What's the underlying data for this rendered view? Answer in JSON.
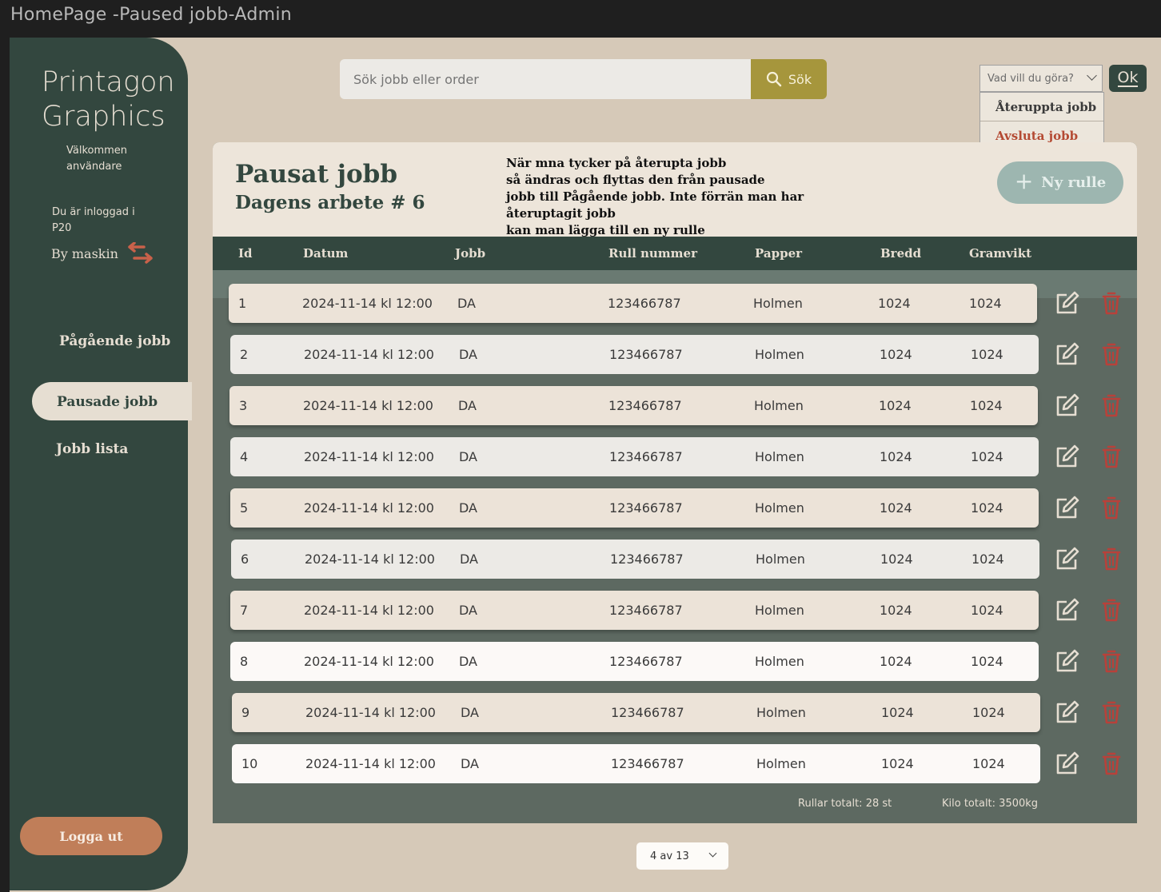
{
  "window": {
    "title": "HomePage -Paused jobb-Admin"
  },
  "sidebar": {
    "brand_line1": "Printagon",
    "brand_line2": "Graphics",
    "welcome_line1": "Välkommen",
    "welcome_line2": "användare",
    "logged_line1": "Du är inloggad i",
    "logged_line2": "P20",
    "switch_label": "By maskin",
    "nav": [
      "Pågående jobb",
      "Pausade jobb",
      "Jobb lista"
    ],
    "active_nav": "Pausade jobb",
    "logout": "Logga ut"
  },
  "search": {
    "placeholder": "Sök jobb eller order",
    "button": "Sök"
  },
  "actions": {
    "placeholder": "Vad vill du göra?",
    "options": [
      "Återuppta jobb",
      "Avsluta jobb"
    ],
    "ok": "Ok"
  },
  "panel": {
    "title": "Pausat jobb",
    "subtitle": "Dagens arbete # 6",
    "note_lines": [
      "När mna tycker på återupta jobb",
      "så ändras och flyttas den från pausade",
      "jobb till Pågående jobb. Inte förrän man har återuptagit jobb",
      "kan man lägga till en ny rulle"
    ],
    "new_roll": "Ny rulle"
  },
  "table": {
    "columns": [
      "Id",
      "Datum",
      "Jobb",
      "Rull nummer",
      "Papper",
      "Bredd",
      "Gramvikt"
    ],
    "rows": [
      [
        "1",
        "2024-11-14 kl 12:00",
        "DA",
        "123466787",
        "Holmen",
        "1024",
        "1024"
      ],
      [
        "2",
        "2024-11-14 kl 12:00",
        "DA",
        "123466787",
        "Holmen",
        "1024",
        "1024"
      ],
      [
        "3",
        "2024-11-14 kl 12:00",
        "DA",
        "123466787",
        "Holmen",
        "1024",
        "1024"
      ],
      [
        "4",
        "2024-11-14 kl 12:00",
        "DA",
        "123466787",
        "Holmen",
        "1024",
        "1024"
      ],
      [
        "5",
        "2024-11-14 kl 12:00",
        "DA",
        "123466787",
        "Holmen",
        "1024",
        "1024"
      ],
      [
        "6",
        "2024-11-14 kl 12:00",
        "DA",
        "123466787",
        "Holmen",
        "1024",
        "1024"
      ],
      [
        "7",
        "2024-11-14 kl 12:00",
        "DA",
        "123466787",
        "Holmen",
        "1024",
        "1024"
      ],
      [
        "8",
        "2024-11-14 kl 12:00",
        "DA",
        "123466787",
        "Holmen",
        "1024",
        "1024"
      ],
      [
        "9",
        "2024-11-14 kl 12:00",
        "DA",
        "123466787",
        "Holmen",
        "1024",
        "1024"
      ],
      [
        "10",
        "2024-11-14 kl 12:00",
        "DA",
        "123466787",
        "Holmen",
        "1024",
        "1024"
      ]
    ],
    "totals": {
      "rolls": "Rullar totalt: 28 st",
      "kilo": "Kilo totalt: 3500kg"
    }
  },
  "pagination": {
    "label": "4 av 13"
  },
  "colors": {
    "sidebar": "#33473f",
    "background": "#d6c9b8",
    "accent_search": "#a6963c",
    "logout": "#c07e59",
    "delete": "#b8413a",
    "new_roll": "#9db6b0"
  },
  "icons": {
    "search": "search-icon",
    "switch": "swap-arrows-icon",
    "edit": "edit-icon",
    "delete": "trash-icon",
    "add": "plus-icon",
    "dropdown": "chevron-down-icon"
  }
}
